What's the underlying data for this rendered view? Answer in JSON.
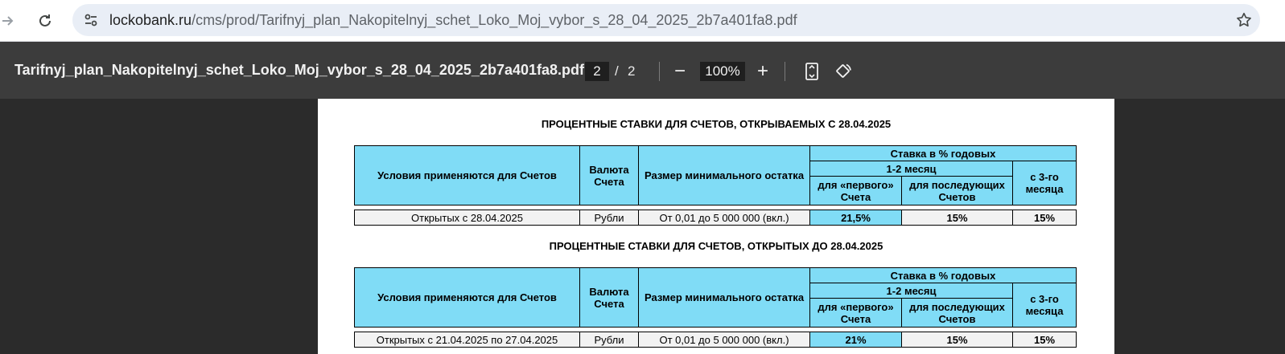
{
  "browser": {
    "url_host": "lockobank.ru",
    "url_path": "/cms/prod/Tarifnyj_plan_Nakopitelnyj_schet_Loko_Moj_vybor_s_28_04_2025_2b7a401fa8.pdf",
    "icons": {
      "forward": "arrow-right-icon",
      "reload": "reload-icon",
      "site_info": "tune-icon",
      "bookmark": "star-icon"
    }
  },
  "pdf_toolbar": {
    "title": "Tarifnyj_plan_Nakopitelnyj_schet_Loko_Moj_vybor_s_28_04_2025_2b7a401fa8.pdf",
    "current_page": "2",
    "page_separator": "/",
    "total_pages": "2",
    "zoom": "100%",
    "zoom_out_label": "−",
    "zoom_in_label": "+",
    "icons": {
      "fit": "fit-page-icon",
      "rotate": "rotate-icon"
    }
  },
  "document": {
    "section1": {
      "heading": "ПРОЦЕНТНЫЕ СТАВКИ ДЛЯ СЧЕТОВ, ОТКРЫВАЕМЫХ С 28.04.2025",
      "headers": {
        "conditions": "Условия применяются для Счетов",
        "currency": "Валюта Счета",
        "min_balance": "Размер минимального остатка",
        "rate_group": "Ставка в % годовых",
        "months_1_2": "1-2 месяц",
        "first_account": "для «первого» Счета",
        "next_accounts": "для последующих Счетов",
        "from_3rd": "с 3-го месяца"
      },
      "row": {
        "conditions": "Открытых с 28.04.2025",
        "currency": "Рубли",
        "min_balance": "От 0,01 до 5 000 000 (вкл.)",
        "first_account": "21,5%",
        "next_accounts": "15%",
        "from_3rd": "15%"
      }
    },
    "section2": {
      "heading": "ПРОЦЕНТНЫЕ СТАВКИ ДЛЯ СЧЕТОВ, ОТКРЫТЫХ ДО 28.04.2025",
      "headers": {
        "conditions": "Условия применяются для Счетов",
        "currency": "Валюта Счета",
        "min_balance": "Размер минимального остатка",
        "rate_group": "Ставка в % годовых",
        "months_1_2": "1-2 месяц",
        "first_account": "для «первого» Счета",
        "next_accounts": "для последующих Счетов",
        "from_3rd": "с 3-го месяца"
      },
      "row": {
        "conditions": "Открытых с 21.04.2025 по 27.04.2025",
        "currency": "Рубли",
        "min_balance": "От 0,01 до 5 000 000 (вкл.)",
        "first_account": "21%",
        "next_accounts": "15%",
        "from_3rd": "15%"
      }
    }
  }
}
